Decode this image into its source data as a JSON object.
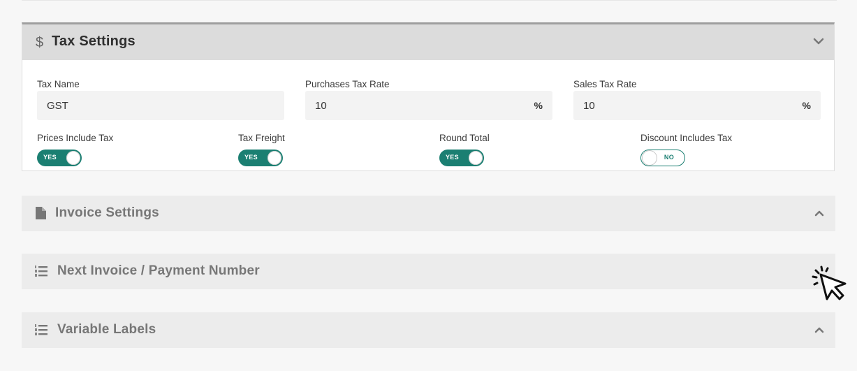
{
  "tax_settings": {
    "icon": "dollar-icon",
    "title": "Tax Settings",
    "tax_name": {
      "label": "Tax Name",
      "value": "GST"
    },
    "purchases_rate": {
      "label": "Purchases Tax Rate",
      "value": "10",
      "unit": "%"
    },
    "sales_rate": {
      "label": "Sales Tax Rate",
      "value": "10",
      "unit": "%"
    },
    "toggles": [
      {
        "label": "Prices Include Tax",
        "state": "YES"
      },
      {
        "label": "Tax Freight",
        "state": "YES"
      },
      {
        "label": "Round Total",
        "state": "YES"
      },
      {
        "label": "Discount Includes Tax",
        "state": "NO"
      }
    ]
  },
  "sections": [
    {
      "icon": "document-icon",
      "title": "Invoice Settings"
    },
    {
      "icon": "numbered-list-icon",
      "title": "Next Invoice / Payment Number"
    },
    {
      "icon": "numbered-list-icon",
      "title": "Variable Labels"
    }
  ],
  "colors": {
    "accent": "#1b7f72",
    "header_bg": "#dcdcdc",
    "collapsed_bg": "#ececec"
  }
}
